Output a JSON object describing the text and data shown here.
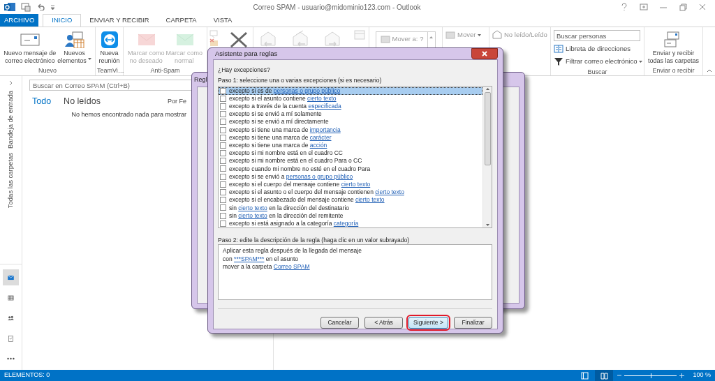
{
  "window": {
    "title": "Correo SPAM - usuario@midominio123.com - Outlook"
  },
  "tabs": [
    {
      "label": "ARCHIVO",
      "kind": "file",
      "selected": false
    },
    {
      "label": "INICIO",
      "kind": "tab",
      "selected": true
    },
    {
      "label": "ENVIAR Y RECIBIR",
      "kind": "tab",
      "selected": false
    },
    {
      "label": "CARPETA",
      "kind": "tab",
      "selected": false
    },
    {
      "label": "VISTA",
      "kind": "tab",
      "selected": false
    }
  ],
  "ribbon": {
    "groups": [
      {
        "label": "Nuevo",
        "buttons": [
          {
            "kind": "new-mail",
            "label": "Nuevo mensaje de\ncorreo electrónico",
            "disabled": false,
            "dropdown": false
          },
          {
            "kind": "new-items",
            "label": "Nuevos\nelementos",
            "disabled": false,
            "dropdown": true
          }
        ]
      },
      {
        "label": "TeamVi…",
        "buttons": [
          {
            "kind": "teamviewer",
            "label": "Nueva\nreunión",
            "disabled": false,
            "dropdown": false
          }
        ]
      },
      {
        "label": "Anti-Spam",
        "buttons": [
          {
            "kind": "junk",
            "label": "Marcar como\nno deseado",
            "disabled": true,
            "dropdown": false
          },
          {
            "kind": "normal",
            "label": "Marcar como\nnormal",
            "disabled": true,
            "dropdown": false
          }
        ]
      },
      {
        "buttons": [
          {
            "kind": "ignore-stack",
            "disabled": true,
            "dropdown": false
          },
          {
            "kind": "delete",
            "disabled": false,
            "dropdown": false
          }
        ]
      },
      {
        "buttons": [
          {
            "kind": "reply",
            "disabled": true,
            "dropdown": false
          },
          {
            "kind": "reply-all",
            "disabled": true,
            "dropdown": false
          },
          {
            "kind": "forward",
            "disabled": true,
            "dropdown": false
          },
          {
            "kind": "more",
            "disabled": true,
            "dropdown": false
          }
        ]
      },
      {
        "gallery": {
          "label": "Mover a: ?"
        }
      },
      {
        "small": [
          {
            "kind": "move",
            "label": "Mover",
            "disabled": true,
            "dropdown": true
          }
        ]
      },
      {
        "small": [
          {
            "kind": "unread",
            "label": "No leído/Leído",
            "disabled": true,
            "dropdown": false
          }
        ]
      },
      {
        "label": "Buscar",
        "search": {
          "placeholder": "Buscar personas"
        },
        "small": [
          {
            "kind": "address-book",
            "label": "Libreta de direcciones",
            "disabled": false,
            "dropdown": false
          },
          {
            "kind": "filter",
            "label": "Filtrar correo electrónico",
            "disabled": false,
            "dropdown": true
          }
        ]
      },
      {
        "label": "Enviar o recibir",
        "buttons": [
          {
            "kind": "send-receive",
            "label": "Enviar y recibir\ntodas las carpetas",
            "disabled": false,
            "dropdown": false
          }
        ]
      }
    ]
  },
  "folder_pane": {
    "labels": [
      "Bandeja de entrada",
      "Todas las carpetas"
    ]
  },
  "nav": [
    {
      "kind": "mail",
      "selected": true
    },
    {
      "kind": "calendar",
      "selected": false
    },
    {
      "kind": "people",
      "selected": false
    },
    {
      "kind": "tasks",
      "selected": false
    },
    {
      "kind": "more",
      "selected": false
    }
  ],
  "message_list": {
    "search": {
      "placeholder": "Buscar en Correo SPAM (Ctrl+B)"
    },
    "filters": [
      {
        "label": "Todo",
        "selected": true
      },
      {
        "label": "No leídos",
        "selected": false
      }
    ],
    "sort": "Por Fe",
    "empty": "No hemos encontrado nada para mostrar"
  },
  "back_dialog": {
    "title": "Regl"
  },
  "dialog": {
    "title": "Asistente para reglas",
    "question": "¿Hay excepciones?",
    "step1": "Paso 1: seleccione una o varias excepciones (si es necesario)",
    "conditions": [
      {
        "parts": [
          {
            "text": "excepto si es de "
          },
          {
            "text": "personas o grupo público",
            "link": true
          }
        ],
        "checked": false,
        "selected": true
      },
      {
        "parts": [
          {
            "text": "excepto si el asunto contiene "
          },
          {
            "text": "cierto texto",
            "link": true
          }
        ],
        "checked": false,
        "selected": false
      },
      {
        "parts": [
          {
            "text": "excepto a través de la cuenta "
          },
          {
            "text": "especificada",
            "link": true
          }
        ],
        "checked": false,
        "selected": false
      },
      {
        "parts": [
          {
            "text": "excepto si se envió a mí solamente"
          }
        ],
        "checked": false,
        "selected": false
      },
      {
        "parts": [
          {
            "text": "excepto si se envió a mí directamente"
          }
        ],
        "checked": false,
        "selected": false
      },
      {
        "parts": [
          {
            "text": "excepto si tiene una marca de "
          },
          {
            "text": "importancia",
            "link": true
          }
        ],
        "checked": false,
        "selected": false
      },
      {
        "parts": [
          {
            "text": "excepto si tiene una marca de "
          },
          {
            "text": "carácter",
            "link": true
          }
        ],
        "checked": false,
        "selected": false
      },
      {
        "parts": [
          {
            "text": "excepto si tiene una marca de "
          },
          {
            "text": "acción",
            "link": true
          }
        ],
        "checked": false,
        "selected": false
      },
      {
        "parts": [
          {
            "text": "excepto si mi nombre está en el cuadro CC"
          }
        ],
        "checked": false,
        "selected": false
      },
      {
        "parts": [
          {
            "text": "excepto si mi nombre está en el cuadro Para o CC"
          }
        ],
        "checked": false,
        "selected": false
      },
      {
        "parts": [
          {
            "text": "excepto cuando mi nombre no esté en el cuadro Para"
          }
        ],
        "checked": false,
        "selected": false
      },
      {
        "parts": [
          {
            "text": "excepto si se envió a "
          },
          {
            "text": "personas o grupo público",
            "link": true
          }
        ],
        "checked": false,
        "selected": false
      },
      {
        "parts": [
          {
            "text": "excepto si el cuerpo del mensaje contiene "
          },
          {
            "text": "cierto texto",
            "link": true
          }
        ],
        "checked": false,
        "selected": false
      },
      {
        "parts": [
          {
            "text": "excepto si el asunto o el cuerpo del mensaje contienen "
          },
          {
            "text": "cierto texto",
            "link": true
          }
        ],
        "checked": false,
        "selected": false
      },
      {
        "parts": [
          {
            "text": "excepto si el encabezado del mensaje contiene "
          },
          {
            "text": "cierto texto",
            "link": true
          }
        ],
        "checked": false,
        "selected": false
      },
      {
        "parts": [
          {
            "text": "sin "
          },
          {
            "text": "cierto texto",
            "link": true
          },
          {
            "text": " en la dirección del destinatario"
          }
        ],
        "checked": false,
        "selected": false
      },
      {
        "parts": [
          {
            "text": "sin "
          },
          {
            "text": "cierto texto",
            "link": true
          },
          {
            "text": " en la dirección del remitente"
          }
        ],
        "checked": false,
        "selected": false
      },
      {
        "parts": [
          {
            "text": "excepto si está asignado a la categoría "
          },
          {
            "text": "categoría",
            "link": true
          }
        ],
        "checked": false,
        "selected": false
      }
    ],
    "step2": "Paso 2: edite la descripción de la regla (haga clic en un valor subrayado)",
    "description": [
      [
        {
          "text": "Aplicar esta regla después de la llegada del mensaje"
        }
      ],
      [
        {
          "text": "con "
        },
        {
          "text": "***SPAM***",
          "link": true
        },
        {
          "text": " en el asunto"
        }
      ],
      [
        {
          "text": "mover a la carpeta "
        },
        {
          "text": "Correo SPAM",
          "link": true
        }
      ]
    ],
    "buttons": [
      {
        "label": "Cancelar",
        "highlighted": false
      },
      {
        "label": "< Atrás",
        "highlighted": false
      },
      {
        "label": "Siguiente >",
        "highlighted": true
      },
      {
        "label": "Finalizar",
        "highlighted": false
      }
    ]
  },
  "status_bar": {
    "items": "ELEMENTOS: 0",
    "views": [
      {
        "kind": "normal",
        "selected": false
      },
      {
        "kind": "reading",
        "selected": true
      }
    ],
    "zoom": {
      "level": 0.5
    },
    "zoom_text": "100 %"
  }
}
